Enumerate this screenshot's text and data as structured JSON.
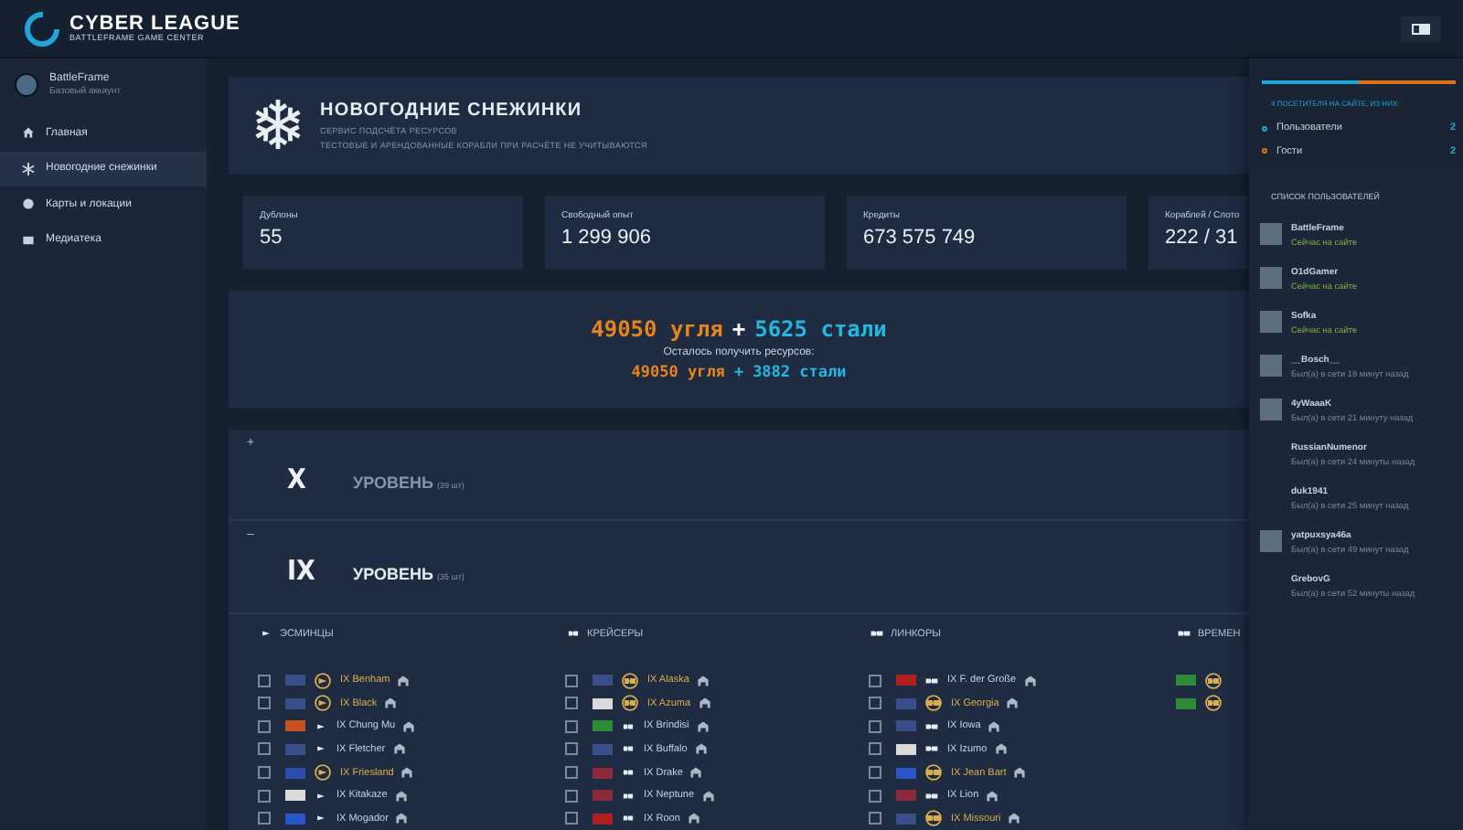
{
  "header": {
    "logo_title": "CYBER LEAGUE",
    "logo_subtitle": "BATTLEFRAME GAME CENTER"
  },
  "sidebar": {
    "profile": {
      "name": "BattleFrame",
      "status": "Базовый аккаунт"
    },
    "items": [
      {
        "label": "Главная",
        "selected": false
      },
      {
        "label": "Новогодние снежинки",
        "selected": true
      },
      {
        "label": "Карты и локации",
        "selected": false
      },
      {
        "label": "Медиатека",
        "selected": false
      }
    ]
  },
  "banner": {
    "title": "НОВОГОДНИЕ СНЕЖИНКИ",
    "subtitle": "СЕРВИС ПОДСЧЁТА РЕСУРСОВ",
    "note": "ТЕСТОВЫЕ И АРЕНДОВАННЫЕ КОРАБЛИ ПРИ РАСЧЁТЕ НЕ УЧИТЫВАЮТСЯ"
  },
  "stats": [
    {
      "label": "Дублоны",
      "value": "55"
    },
    {
      "label": "Свободный опыт",
      "value": "1 299 906"
    },
    {
      "label": "Кредиты",
      "value": "673 575 749"
    },
    {
      "label": "Кораблей / Слото",
      "value": "222 / 31"
    }
  ],
  "resources": {
    "total_coal": "49050 угля",
    "plus": "+",
    "total_steel": "5625 стали",
    "remaining_label": "Осталось получить ресурсов:",
    "remaining_coal": "49050 угля",
    "remaining_plus": "+",
    "remaining_steel": "3882 стали"
  },
  "levels": [
    {
      "toggle": "+",
      "numeral": "X",
      "label": "УРОВЕНЬ",
      "count": "(39 шт)",
      "expanded": false
    },
    {
      "toggle": "–",
      "numeral": "IX",
      "label": "УРОВЕНЬ",
      "count": "(35 шт)",
      "expanded": true
    }
  ],
  "ship_columns": [
    {
      "title": "ЭСМИНЦЫ",
      "kind": "destroyer",
      "ships": [
        {
          "name": "IX Benham",
          "premium": true,
          "checked": false,
          "color": "#3a4f8a"
        },
        {
          "name": "IX Black",
          "premium": true,
          "checked": false,
          "color": "#3a4f8a"
        },
        {
          "name": "IX Chung Mu",
          "premium": false,
          "checked": false,
          "color": "#c8501a"
        },
        {
          "name": "IX Fletcher",
          "premium": false,
          "checked": false,
          "color": "#3a4f8a"
        },
        {
          "name": "IX Friesland",
          "premium": true,
          "checked": false,
          "color": "#2a4fa8"
        },
        {
          "name": "IX Kitakaze",
          "premium": false,
          "checked": false,
          "color": "#d9d9d9"
        },
        {
          "name": "IX Mogador",
          "premium": false,
          "checked": false,
          "color": "#2b56c8"
        }
      ]
    },
    {
      "title": "КРЕЙСЕРЫ",
      "kind": "cruiser",
      "ships": [
        {
          "name": "IX Alaska",
          "premium": true,
          "checked": false,
          "color": "#3a4f8a"
        },
        {
          "name": "IX Azuma",
          "premium": true,
          "checked": false,
          "color": "#d9d9d9"
        },
        {
          "name": "IX Brindisi",
          "premium": false,
          "checked": false,
          "color": "#2e8b3a"
        },
        {
          "name": "IX Buffalo",
          "premium": false,
          "checked": false,
          "color": "#3a4f8a"
        },
        {
          "name": "IX Drake",
          "premium": false,
          "checked": false,
          "color": "#8a2a3a"
        },
        {
          "name": "IX Neptune",
          "premium": false,
          "checked": false,
          "color": "#8a2a3a"
        },
        {
          "name": "IX Roon",
          "premium": false,
          "checked": false,
          "color": "#b02020"
        }
      ]
    },
    {
      "title": "ЛИНКОРЫ",
      "kind": "battleship",
      "ships": [
        {
          "name": "IX F. der Große",
          "premium": false,
          "checked": false,
          "color": "#b02020"
        },
        {
          "name": "IX Georgia",
          "premium": true,
          "checked": false,
          "color": "#3a4f8a"
        },
        {
          "name": "IX Iowa",
          "premium": false,
          "checked": false,
          "color": "#3a4f8a"
        },
        {
          "name": "IX Izumo",
          "premium": false,
          "checked": false,
          "color": "#d9d9d9"
        },
        {
          "name": "IX Jean Bart",
          "premium": true,
          "checked": false,
          "color": "#2b56c8"
        },
        {
          "name": "IX Lion",
          "premium": false,
          "checked": false,
          "color": "#8a2a3a"
        },
        {
          "name": "IX Missouri",
          "premium": true,
          "checked": false,
          "color": "#3a4f8a"
        }
      ]
    },
    {
      "title": "ВРЕМЕН",
      "kind": "temporary",
      "ships": [
        {
          "premium": true,
          "color": "#2e8b3a"
        },
        {
          "premium": true,
          "color": "#2e8b3a"
        }
      ]
    }
  ],
  "visitors": {
    "summary": "4 ПОСЕТИТЕЛЯ НА САЙТЕ, ИЗ НИХ:",
    "level": 0.5,
    "groups": [
      {
        "label": "Пользователи",
        "count": "2",
        "color": "#1fa6d6"
      },
      {
        "label": "Гости",
        "count": "2",
        "color": "#e0701a"
      }
    ],
    "list_title": "СПИСОК ПОЛЬЗОВАТЕЛЕЙ",
    "users": [
      {
        "name": "BattleFrame",
        "status": "Сейчас на сайте",
        "online": true,
        "avatar": true
      },
      {
        "name": "O1dGamer",
        "status": "Сейчас на сайте",
        "online": true,
        "avatar": true
      },
      {
        "name": "Sofka",
        "status": "Сейчас на сайте",
        "online": true,
        "avatar": true
      },
      {
        "name": "__Bosch__",
        "status": "Был(а) в сети 18 минут назад",
        "online": false,
        "avatar": true
      },
      {
        "name": "4yWaaaK",
        "status": "Был(а) в сети 21 минуту назад",
        "online": false,
        "avatar": true
      },
      {
        "name": "RussianNumenor",
        "status": "Был(а) в сети 24 минуты назад",
        "online": false,
        "avatar": false
      },
      {
        "name": "duk1941",
        "status": "Был(а) в сети 25 минут назад",
        "online": false,
        "avatar": false
      },
      {
        "name": "yatpuxsya46a",
        "status": "Был(а) в сети 49 минут назад",
        "online": false,
        "avatar": true
      },
      {
        "name": "GrebovG",
        "status": "Был(а) в сети 52 минуты назад",
        "online": false,
        "avatar": false
      }
    ]
  }
}
